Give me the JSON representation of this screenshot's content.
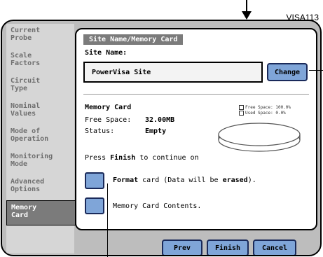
{
  "figure_label": "VISA113",
  "sidebar": {
    "items": [
      {
        "label": "Current\nProbe",
        "active": false
      },
      {
        "label": "Scale\nFactors",
        "active": false
      },
      {
        "label": "Circuit\nType",
        "active": false
      },
      {
        "label": "Nominal\nValues",
        "active": false
      },
      {
        "label": "Mode of\nOperation",
        "active": false
      },
      {
        "label": "Monitoring\nMode",
        "active": false
      },
      {
        "label": "Advanced\nOptions",
        "active": false
      },
      {
        "label": "Memory\nCard",
        "active": true
      }
    ]
  },
  "panel": {
    "title": "Site Name/Memory Card",
    "site_name_label": "Site Name:",
    "site_name_value": "PowerVisa Site",
    "change_label": "Change",
    "memory_card_label": "Memory Card",
    "free_space_label": "Free Space:",
    "free_space_value": "32.00MB",
    "status_label": "Status:",
    "status_value": "Empty",
    "legend_free": "Free Space: 100.0%",
    "legend_used": "Used Space: 0.0%",
    "press_prefix": "Press",
    "press_finish": "Finish",
    "press_suffix": "to continue on",
    "format_prefix": "Format",
    "format_middle": "card (Data will be",
    "format_erased": "erased",
    "format_end": ").",
    "contents_label": "Memory Card Contents."
  },
  "buttons": {
    "prev": "Prev",
    "finish": "Finish",
    "cancel": "Cancel"
  },
  "colors": {
    "button_blue": "#7fa5d8",
    "sidebar_active": "#7b7b7b"
  }
}
